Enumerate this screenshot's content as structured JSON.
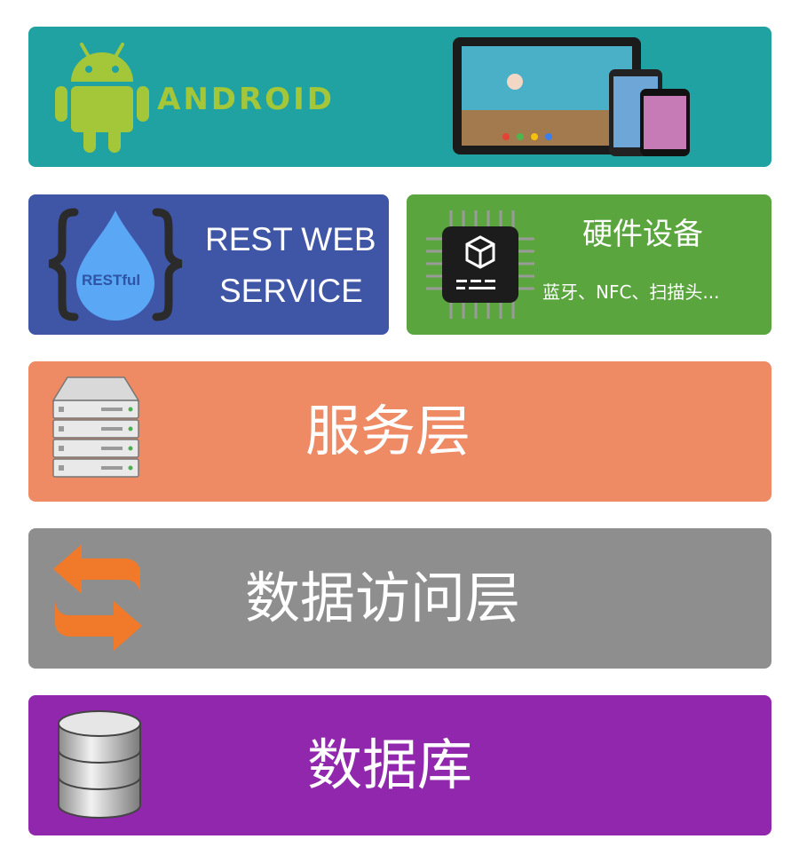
{
  "layers": {
    "client": {
      "brand_text": "ANDROID",
      "color": "#20a2a2",
      "icons": [
        "android-robot-icon",
        "devices-icon"
      ]
    },
    "rest": {
      "badge_text": "RESTful",
      "title_line1": "REST WEB",
      "title_line2": "SERVICE",
      "color": "#3f55a6",
      "icon": "water-drop-braces-icon"
    },
    "hardware": {
      "title": "硬件设备",
      "subtitle": "蓝牙、NFC、扫描头...",
      "color": "#5aa53e",
      "icon": "chip-icon"
    },
    "service": {
      "title": "服务层",
      "color": "#ee8a64",
      "icon": "server-rack-icon"
    },
    "data_access": {
      "title": "数据访问层",
      "color": "#8e8e8e",
      "icon": "sync-arrows-icon"
    },
    "database": {
      "title": "数据库",
      "color": "#9127ac",
      "icon": "database-icon"
    }
  }
}
